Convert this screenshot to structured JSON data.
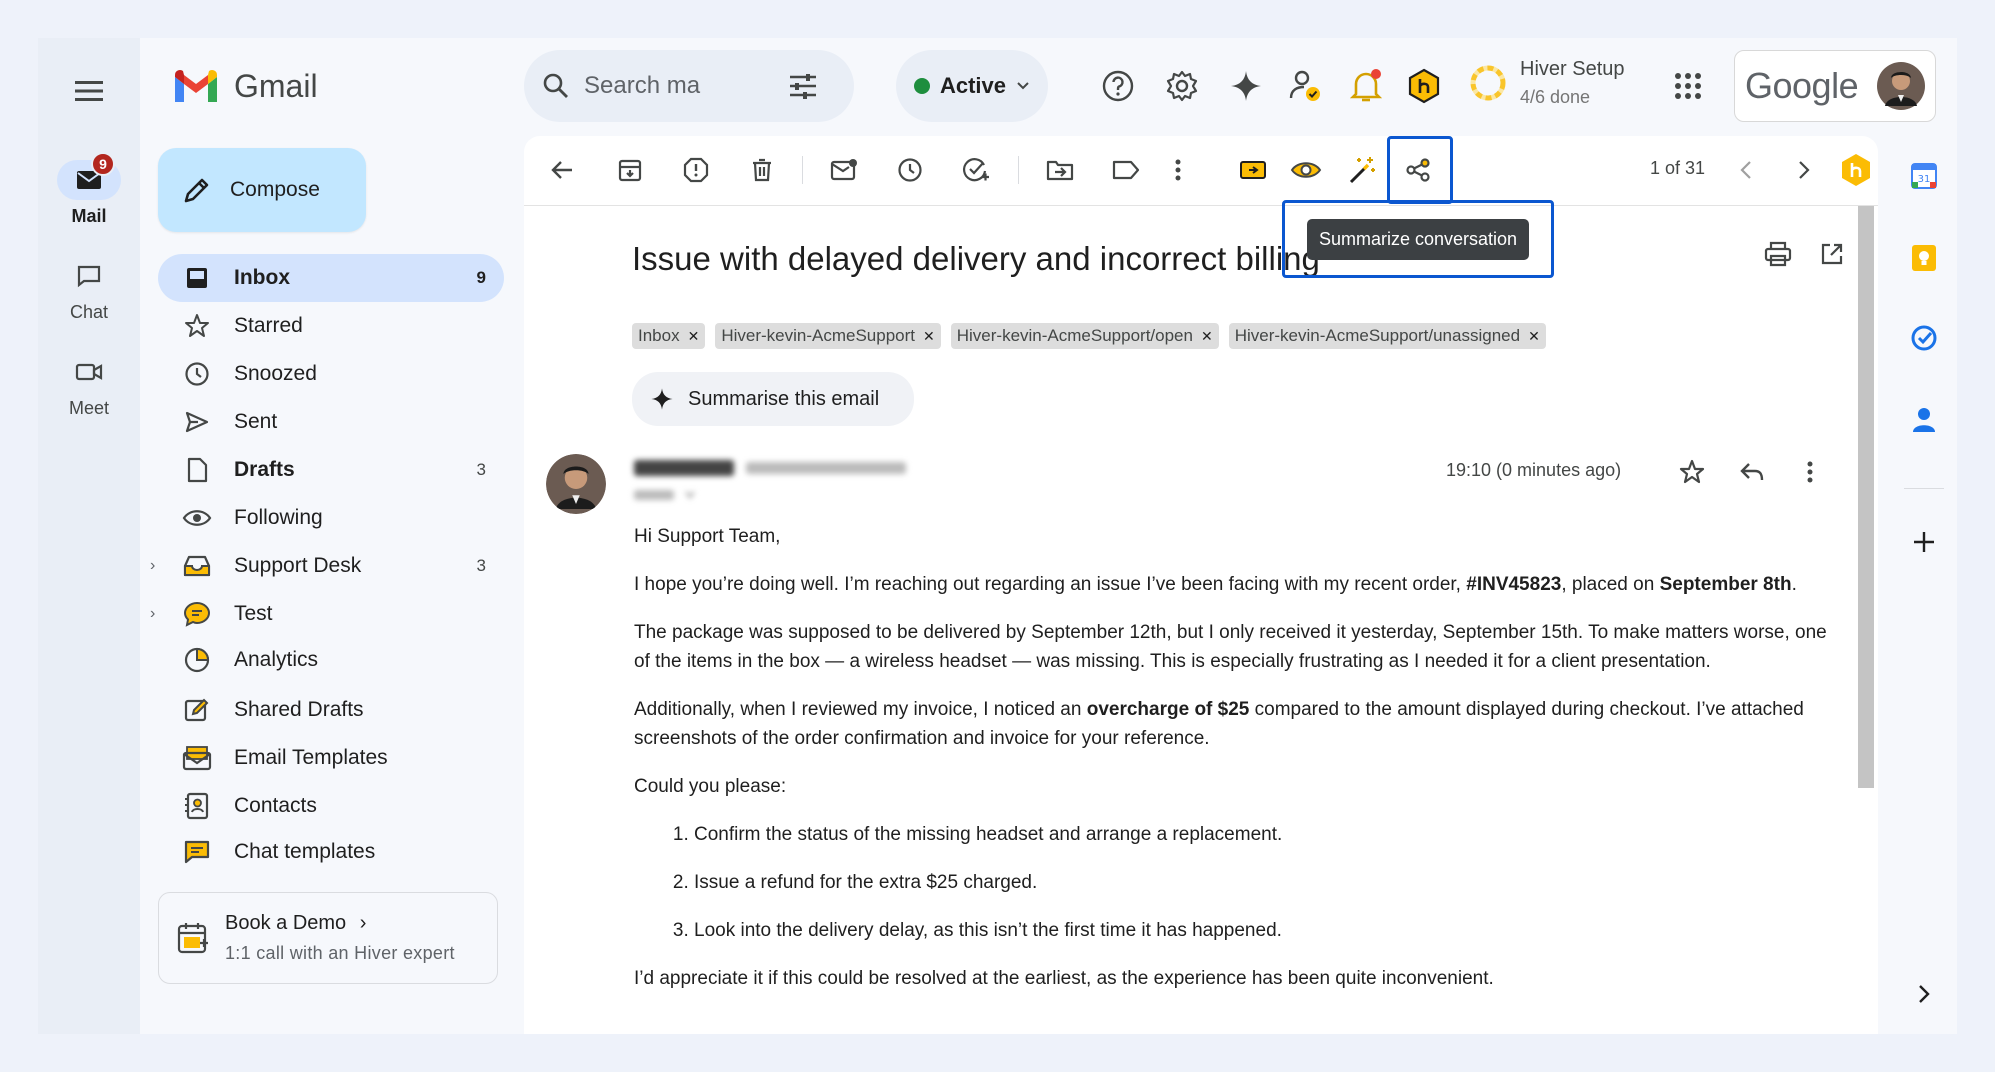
{
  "rail": {
    "items": [
      {
        "label": "Mail",
        "badge": "9"
      },
      {
        "label": "Chat"
      },
      {
        "label": "Meet"
      }
    ]
  },
  "header": {
    "logo_text": "Gmail",
    "search_placeholder": "Search ma",
    "status_label": "Active",
    "setup_title": "Hiver Setup",
    "setup_progress": "4/6 done",
    "google_label": "Google"
  },
  "nav": {
    "compose_label": "Compose",
    "items": [
      {
        "label": "Inbox",
        "count": "9",
        "icon": "inbox-icon"
      },
      {
        "label": "Starred",
        "icon": "star-icon"
      },
      {
        "label": "Snoozed",
        "icon": "clock-icon"
      },
      {
        "label": "Sent",
        "icon": "send-icon"
      },
      {
        "label": "Drafts",
        "count": "3",
        "icon": "draft-icon"
      },
      {
        "label": "Following",
        "icon": "eye-icon"
      },
      {
        "label": "Support Desk",
        "count": "3",
        "icon": "support-desk-icon"
      },
      {
        "label": "Test",
        "icon": "chat-bubble-icon"
      },
      {
        "label": "Analytics",
        "icon": "pie-chart-icon"
      },
      {
        "label": "Shared Drafts",
        "icon": "shared-drafts-icon"
      },
      {
        "label": "Email Templates",
        "icon": "email-template-icon"
      },
      {
        "label": "Contacts",
        "icon": "contacts-icon"
      },
      {
        "label": "Chat templates",
        "icon": "chat-template-icon"
      }
    ],
    "demo_title": "Book a Demo",
    "demo_subtitle": "1:1 call with an Hiver expert"
  },
  "toolbar": {
    "pager": "1 of 31",
    "tooltip": "Summarize conversation"
  },
  "email": {
    "subject": "Issue with delayed delivery and incorrect billing",
    "labels": [
      "Inbox",
      "Hiver-kevin-AcmeSupport",
      "Hiver-kevin-AcmeSupport/open",
      "Hiver-kevin-AcmeSupport/unassigned"
    ],
    "summarise_label": "Summarise this email",
    "time": "19:10 (0 minutes ago)",
    "greeting": "Hi Support Team,",
    "p1_a": "I hope you’re doing well. I’m reaching out regarding an issue I’ve been facing with my recent order, ",
    "p1_order": "#INV45823",
    "p1_b": ", placed on ",
    "p1_date": "September 8th",
    "p1_c": ".",
    "p2": "The package was supposed to be delivered by September 12th, but I only received it yesterday, September 15th. To make matters worse, one of the items in the box — a wireless headset — was missing. This is especially frustrating as I needed it for a client presentation.",
    "p3_a": "Additionally, when I reviewed my invoice, I noticed an ",
    "p3_bold": "overcharge of $25",
    "p3_b": " compared to the amount displayed during checkout. I’ve attached screenshots of the order confirmation and invoice for your reference.",
    "p4": "Could you please:",
    "list": [
      "Confirm the status of the missing headset and arrange a replacement.",
      "Issue a refund for the extra $25 charged.",
      "Look into the delivery delay, as this isn’t the first time it has happened."
    ],
    "p5": "I’d appreciate it if this could be resolved at the earliest, as the experience has been quite inconvenient."
  },
  "colors": {
    "accent": "#0b57d0",
    "selected_nav": "#d3e3fd",
    "compose": "#c2e7ff",
    "badge": "#b3261e"
  }
}
